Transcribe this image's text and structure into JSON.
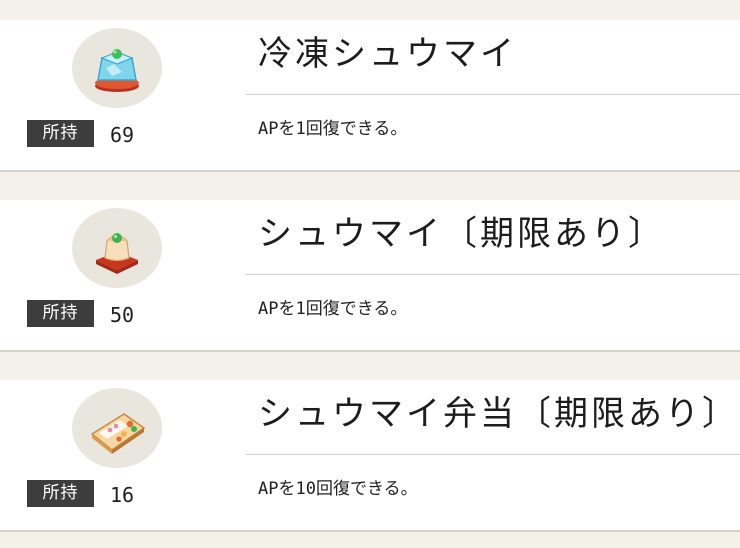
{
  "items": [
    {
      "name": "冷凍シュウマイ",
      "owned_label": "所持",
      "count": "69",
      "description": "APを1回復できる。",
      "icon": "frozen-shumai-icon"
    },
    {
      "name": "シュウマイ〔期限あり〕",
      "owned_label": "所持",
      "count": "50",
      "description": "APを1回復できる。",
      "icon": "shumai-icon"
    },
    {
      "name": "シュウマイ弁当〔期限あり〕",
      "owned_label": "所持",
      "count": "16",
      "description": "APを10回復できる。",
      "icon": "shumai-bento-icon"
    }
  ],
  "colors": {
    "background": "#f4f1ea",
    "card": "#ffffff",
    "badge": "#3d3d3d",
    "icon_circle": "#e9e7dd"
  }
}
